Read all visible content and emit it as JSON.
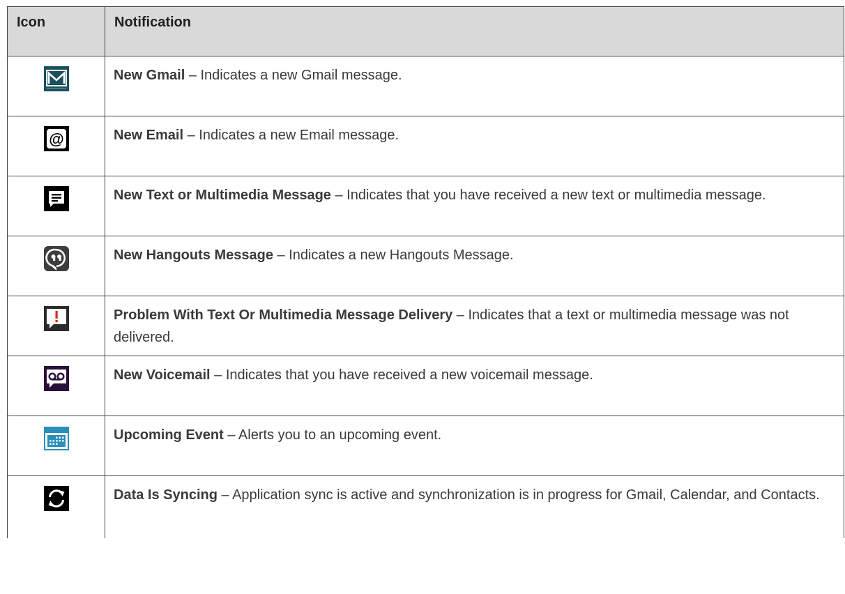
{
  "header": {
    "icon_col": "Icon",
    "notification_col": "Notification"
  },
  "rows": [
    {
      "icon": "gmail-icon",
      "term": "New Gmail",
      "desc": " – Indicates a new Gmail message."
    },
    {
      "icon": "email-at-icon",
      "term": "New Email",
      "desc": " – Indicates a new Email message."
    },
    {
      "icon": "text-message-icon",
      "term": "New Text or Multimedia Message",
      "desc": " – Indicates that you have received a new text or multimedia message."
    },
    {
      "icon": "hangouts-icon",
      "term": "New Hangouts Message",
      "desc": " – Indicates a new Hangouts Message."
    },
    {
      "icon": "message-error-icon",
      "term": "Problem With Text Or Multimedia Message Delivery",
      "desc": " – Indicates that a text or multimedia message was not delivered."
    },
    {
      "icon": "voicemail-icon",
      "term": "New Voicemail",
      "desc": " – Indicates that you have received a new voicemail message."
    },
    {
      "icon": "calendar-icon",
      "term": "Upcoming Event",
      "desc": " – Alerts you to an upcoming event."
    },
    {
      "icon": "sync-icon",
      "term": "Data Is Syncing",
      "desc": " – Application sync is active and synchronization is in progress for Gmail, Calendar, and Contacts."
    }
  ],
  "colors": {
    "header_bg": "#d9d9d9",
    "gmail_teal": "#1a4f5c",
    "voicemail_purple": "#2a0f3a",
    "calendar_blue": "#2a8fb8",
    "error_red": "#d62c1a"
  }
}
